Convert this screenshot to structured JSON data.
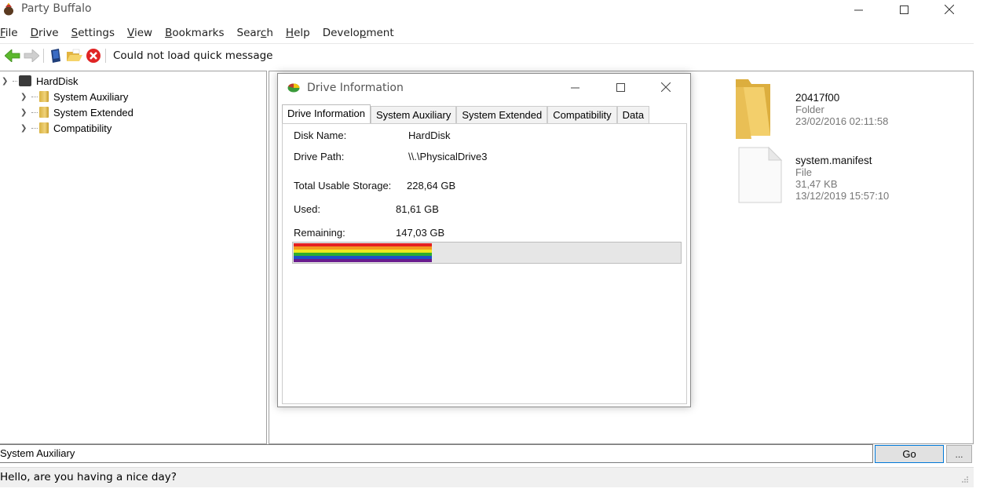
{
  "window": {
    "title": "Party Buffalo",
    "minimize": "—",
    "maximize": "☐",
    "close": "✕"
  },
  "menu": [
    {
      "label": "File",
      "u": "F",
      "rest": "ile"
    },
    {
      "label": "Drive",
      "u": "D",
      "rest": "rive"
    },
    {
      "label": "Settings",
      "u": "S",
      "rest": "ettings"
    },
    {
      "label": "View",
      "u": "V",
      "rest": "iew"
    },
    {
      "label": "Bookmarks",
      "u": "B",
      "rest": "ookmarks"
    },
    {
      "label": "Search",
      "pre": "Sear",
      "u": "c",
      "rest": "h"
    },
    {
      "label": "Help",
      "u": "H",
      "rest": "elp"
    },
    {
      "label": "Development",
      "pre": "Develo",
      "u": "p",
      "rest": "ment"
    }
  ],
  "toolbar": {
    "quick_message": "Could not load quick message",
    "icons": [
      "back-arrow-icon",
      "forward-arrow-icon",
      "device-icon",
      "open-folder-icon",
      "stop-icon"
    ]
  },
  "tree": {
    "root": "HardDisk",
    "children": [
      "System Auxiliary",
      "System Extended",
      "Compatibility"
    ]
  },
  "files": [
    {
      "name": "20417f00",
      "type": "Folder",
      "date": "23/02/2016 02:11:58"
    },
    {
      "name": "system.manifest",
      "type": "File",
      "size": "31,47 KB",
      "date": "13/12/2019 15:57:10"
    }
  ],
  "dialog": {
    "title": "Drive Information",
    "tabs": [
      "Drive Information",
      "System Auxiliary",
      "System Extended",
      "Compatibility",
      "Data"
    ],
    "active_tab": 0,
    "disk_name_label": "Disk Name:",
    "disk_name": "HardDisk",
    "drive_path_label": "Drive Path:",
    "drive_path": "\\\\.\\PhysicalDrive3",
    "total_label": "Total Usable Storage:",
    "total": "228,64 GB",
    "used_label": "Used:",
    "used": "81,61 GB",
    "remaining_label": "Remaining:",
    "remaining": "147,03 GB",
    "used_fraction": 0.357
  },
  "bottom": {
    "path": "System Auxiliary",
    "go": "Go",
    "browse": "...",
    "status": "Hello, are you having a nice day?"
  }
}
